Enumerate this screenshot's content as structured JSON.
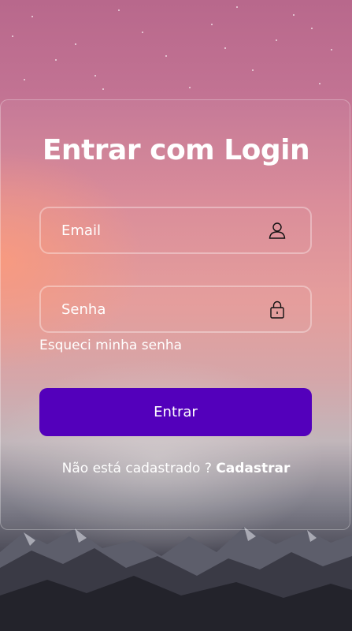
{
  "login": {
    "title": "Entrar com Login",
    "email_placeholder": "Email",
    "password_placeholder": "Senha",
    "forgot_label": "Esqueci minha senha",
    "submit_label": "Entrar",
    "signup_prompt": "Não está cadastrado ?",
    "signup_link": "Cadastrar"
  },
  "icons": {
    "email": "user-icon",
    "password": "lock-icon"
  },
  "colors": {
    "button": "#5300bb",
    "text": "#ffffff"
  }
}
